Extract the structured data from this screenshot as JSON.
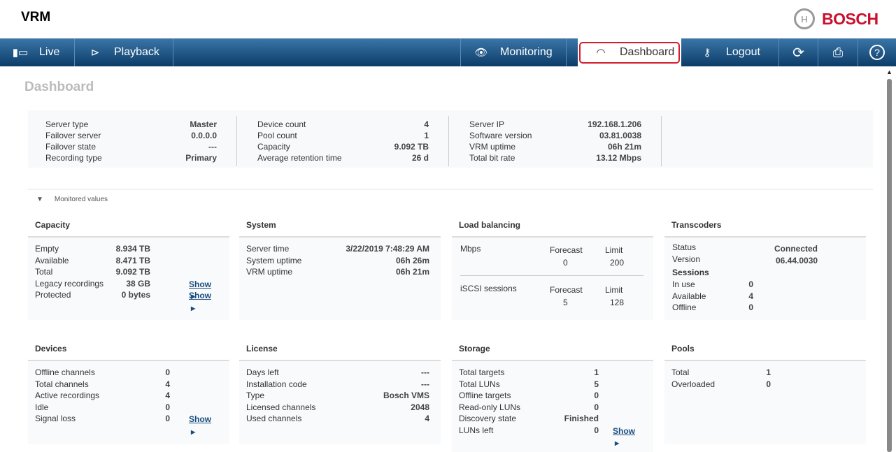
{
  "app_title": "VRM",
  "brand": "BOSCH",
  "nav": {
    "live": "Live",
    "playback": "Playback",
    "monitoring": "Monitoring",
    "dashboard": "Dashboard",
    "logout": "Logout"
  },
  "page_title": "Dashboard",
  "summary": {
    "col1": [
      [
        "Server type",
        "Master"
      ],
      [
        "Failover server",
        "0.0.0.0"
      ],
      [
        "Failover state",
        "---"
      ],
      [
        "Recording type",
        "Primary"
      ]
    ],
    "col2": [
      [
        "Device count",
        "4"
      ],
      [
        "Pool count",
        "1"
      ],
      [
        "Capacity",
        "9.092 TB"
      ],
      [
        "Average retention time",
        "26 d"
      ]
    ],
    "col3": [
      [
        "Server IP",
        "192.168.1.206"
      ],
      [
        "Software version",
        "03.81.0038"
      ],
      [
        "VRM uptime",
        "06h 21m"
      ],
      [
        "Total bit rate",
        "13.12 Mbps"
      ]
    ]
  },
  "monitored_label": "Monitored values",
  "show_label": "Show",
  "capacity": {
    "title": "Capacity",
    "rows": [
      [
        "Empty",
        "8.934 TB"
      ],
      [
        "Available",
        "8.471 TB"
      ],
      [
        "Total",
        "9.092 TB"
      ],
      [
        "Legacy recordings",
        "38 GB"
      ],
      [
        "Protected",
        "0 bytes"
      ]
    ]
  },
  "system": {
    "title": "System",
    "rows": [
      [
        "Server time",
        "3/22/2019 7:48:29 AM"
      ],
      [
        "System uptime",
        "06h 26m"
      ],
      [
        "VRM uptime",
        "06h 21m"
      ]
    ]
  },
  "load": {
    "title": "Load balancing",
    "forecast": "Forecast",
    "limit": "Limit",
    "mbps": {
      "label": "Mbps",
      "forecast": "0",
      "limit": "200"
    },
    "iscsi": {
      "label": "iSCSI sessions",
      "forecast": "5",
      "limit": "128"
    }
  },
  "transcoders": {
    "title": "Transcoders",
    "status_label": "Status",
    "status": "Connected",
    "version_label": "Version",
    "version": "06.44.0030",
    "sessions": "Sessions",
    "rows": [
      [
        "In use",
        "0"
      ],
      [
        "Available",
        "4"
      ],
      [
        "Offline",
        "0"
      ]
    ]
  },
  "devices": {
    "title": "Devices",
    "rows": [
      [
        "Offline channels",
        "0"
      ],
      [
        "Total channels",
        "4"
      ],
      [
        "Active recordings",
        "4"
      ],
      [
        "Idle",
        "0"
      ],
      [
        "Signal loss",
        "0"
      ]
    ]
  },
  "license": {
    "title": "License",
    "rows": [
      [
        "Days left",
        "---"
      ],
      [
        "Installation code",
        "---"
      ],
      [
        "Type",
        "Bosch VMS"
      ],
      [
        "Licensed channels",
        "2048"
      ],
      [
        "Used channels",
        "4"
      ]
    ]
  },
  "storage": {
    "title": "Storage",
    "rows": [
      [
        "Total targets",
        "1"
      ],
      [
        "Total LUNs",
        "5"
      ],
      [
        "Offline targets",
        "0"
      ],
      [
        "Read-only LUNs",
        "0"
      ],
      [
        "Discovery state",
        "Finished"
      ],
      [
        "LUNs left",
        "0"
      ]
    ]
  },
  "pools": {
    "title": "Pools",
    "rows": [
      [
        "Total",
        "1"
      ],
      [
        "Overloaded",
        "0"
      ]
    ]
  }
}
